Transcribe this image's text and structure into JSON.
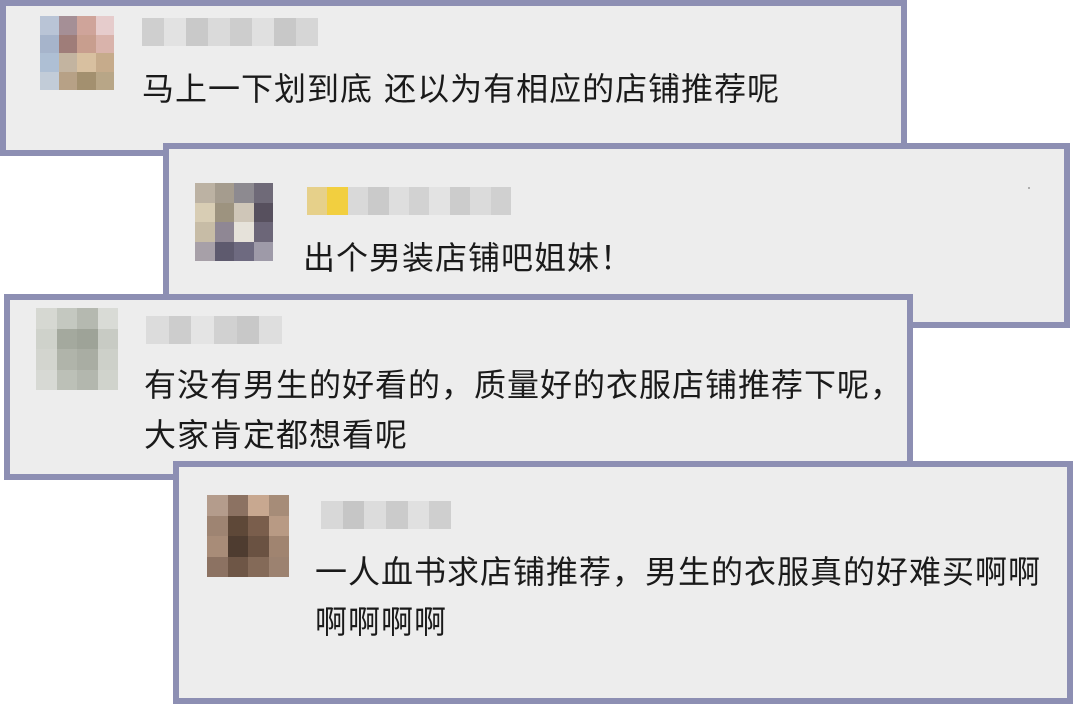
{
  "comments": [
    {
      "text": "马上一下划到底 还以为有相应的店铺推荐呢"
    },
    {
      "text": "出个男装店铺吧姐妹！"
    },
    {
      "text": "有没有男生的好看的，质量好的衣服店铺推荐下呢，大家肯定都想看呢"
    },
    {
      "text": "一人血书求店铺推荐，男生的衣服真的好难买啊啊啊啊啊啊"
    }
  ],
  "colors": {
    "card_background": "#ededed",
    "card_border": "#8d8fb3",
    "text": "#1a1a1a"
  }
}
